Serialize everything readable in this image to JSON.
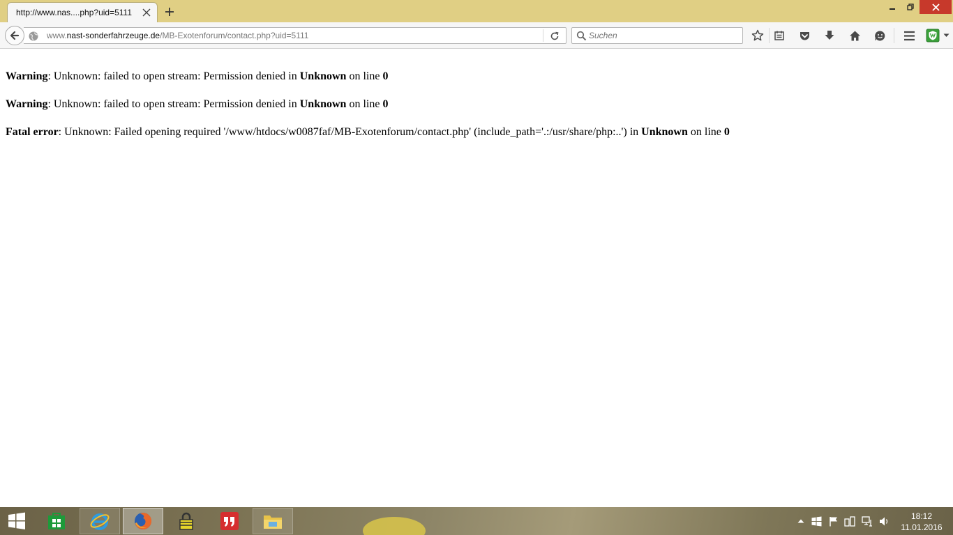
{
  "browser": {
    "tab": {
      "title": "http://www.nas....php?uid=5111"
    },
    "url": {
      "prefix": "www.",
      "host": "nast-sonderfahrzeuge.de",
      "path": "/MB-Exotenforum/contact.php?uid=5111"
    },
    "search": {
      "placeholder": "Suchen"
    }
  },
  "page": {
    "messages": [
      {
        "label": "Warning",
        "text": ": Unknown: failed to open stream: Permission denied in ",
        "location": "Unknown",
        "line_text": " on line ",
        "line": "0"
      },
      {
        "label": "Warning",
        "text": ": Unknown: failed to open stream: Permission denied in ",
        "location": "Unknown",
        "line_text": " on line ",
        "line": "0"
      },
      {
        "label": "Fatal error",
        "text": ": Unknown: Failed opening required '/www/htdocs/w0087faf/MB-Exotenforum/contact.php' (include_path='.:/usr/share/php:..') in ",
        "location": "Unknown",
        "line_text": " on line ",
        "line": "0"
      }
    ]
  },
  "taskbar": {
    "clock": {
      "time": "18:12",
      "date": "11.01.2016"
    }
  },
  "colors": {
    "titlebar": "#e0cf84",
    "close_button": "#c7392b",
    "toolbar": "#f6f6f6"
  }
}
